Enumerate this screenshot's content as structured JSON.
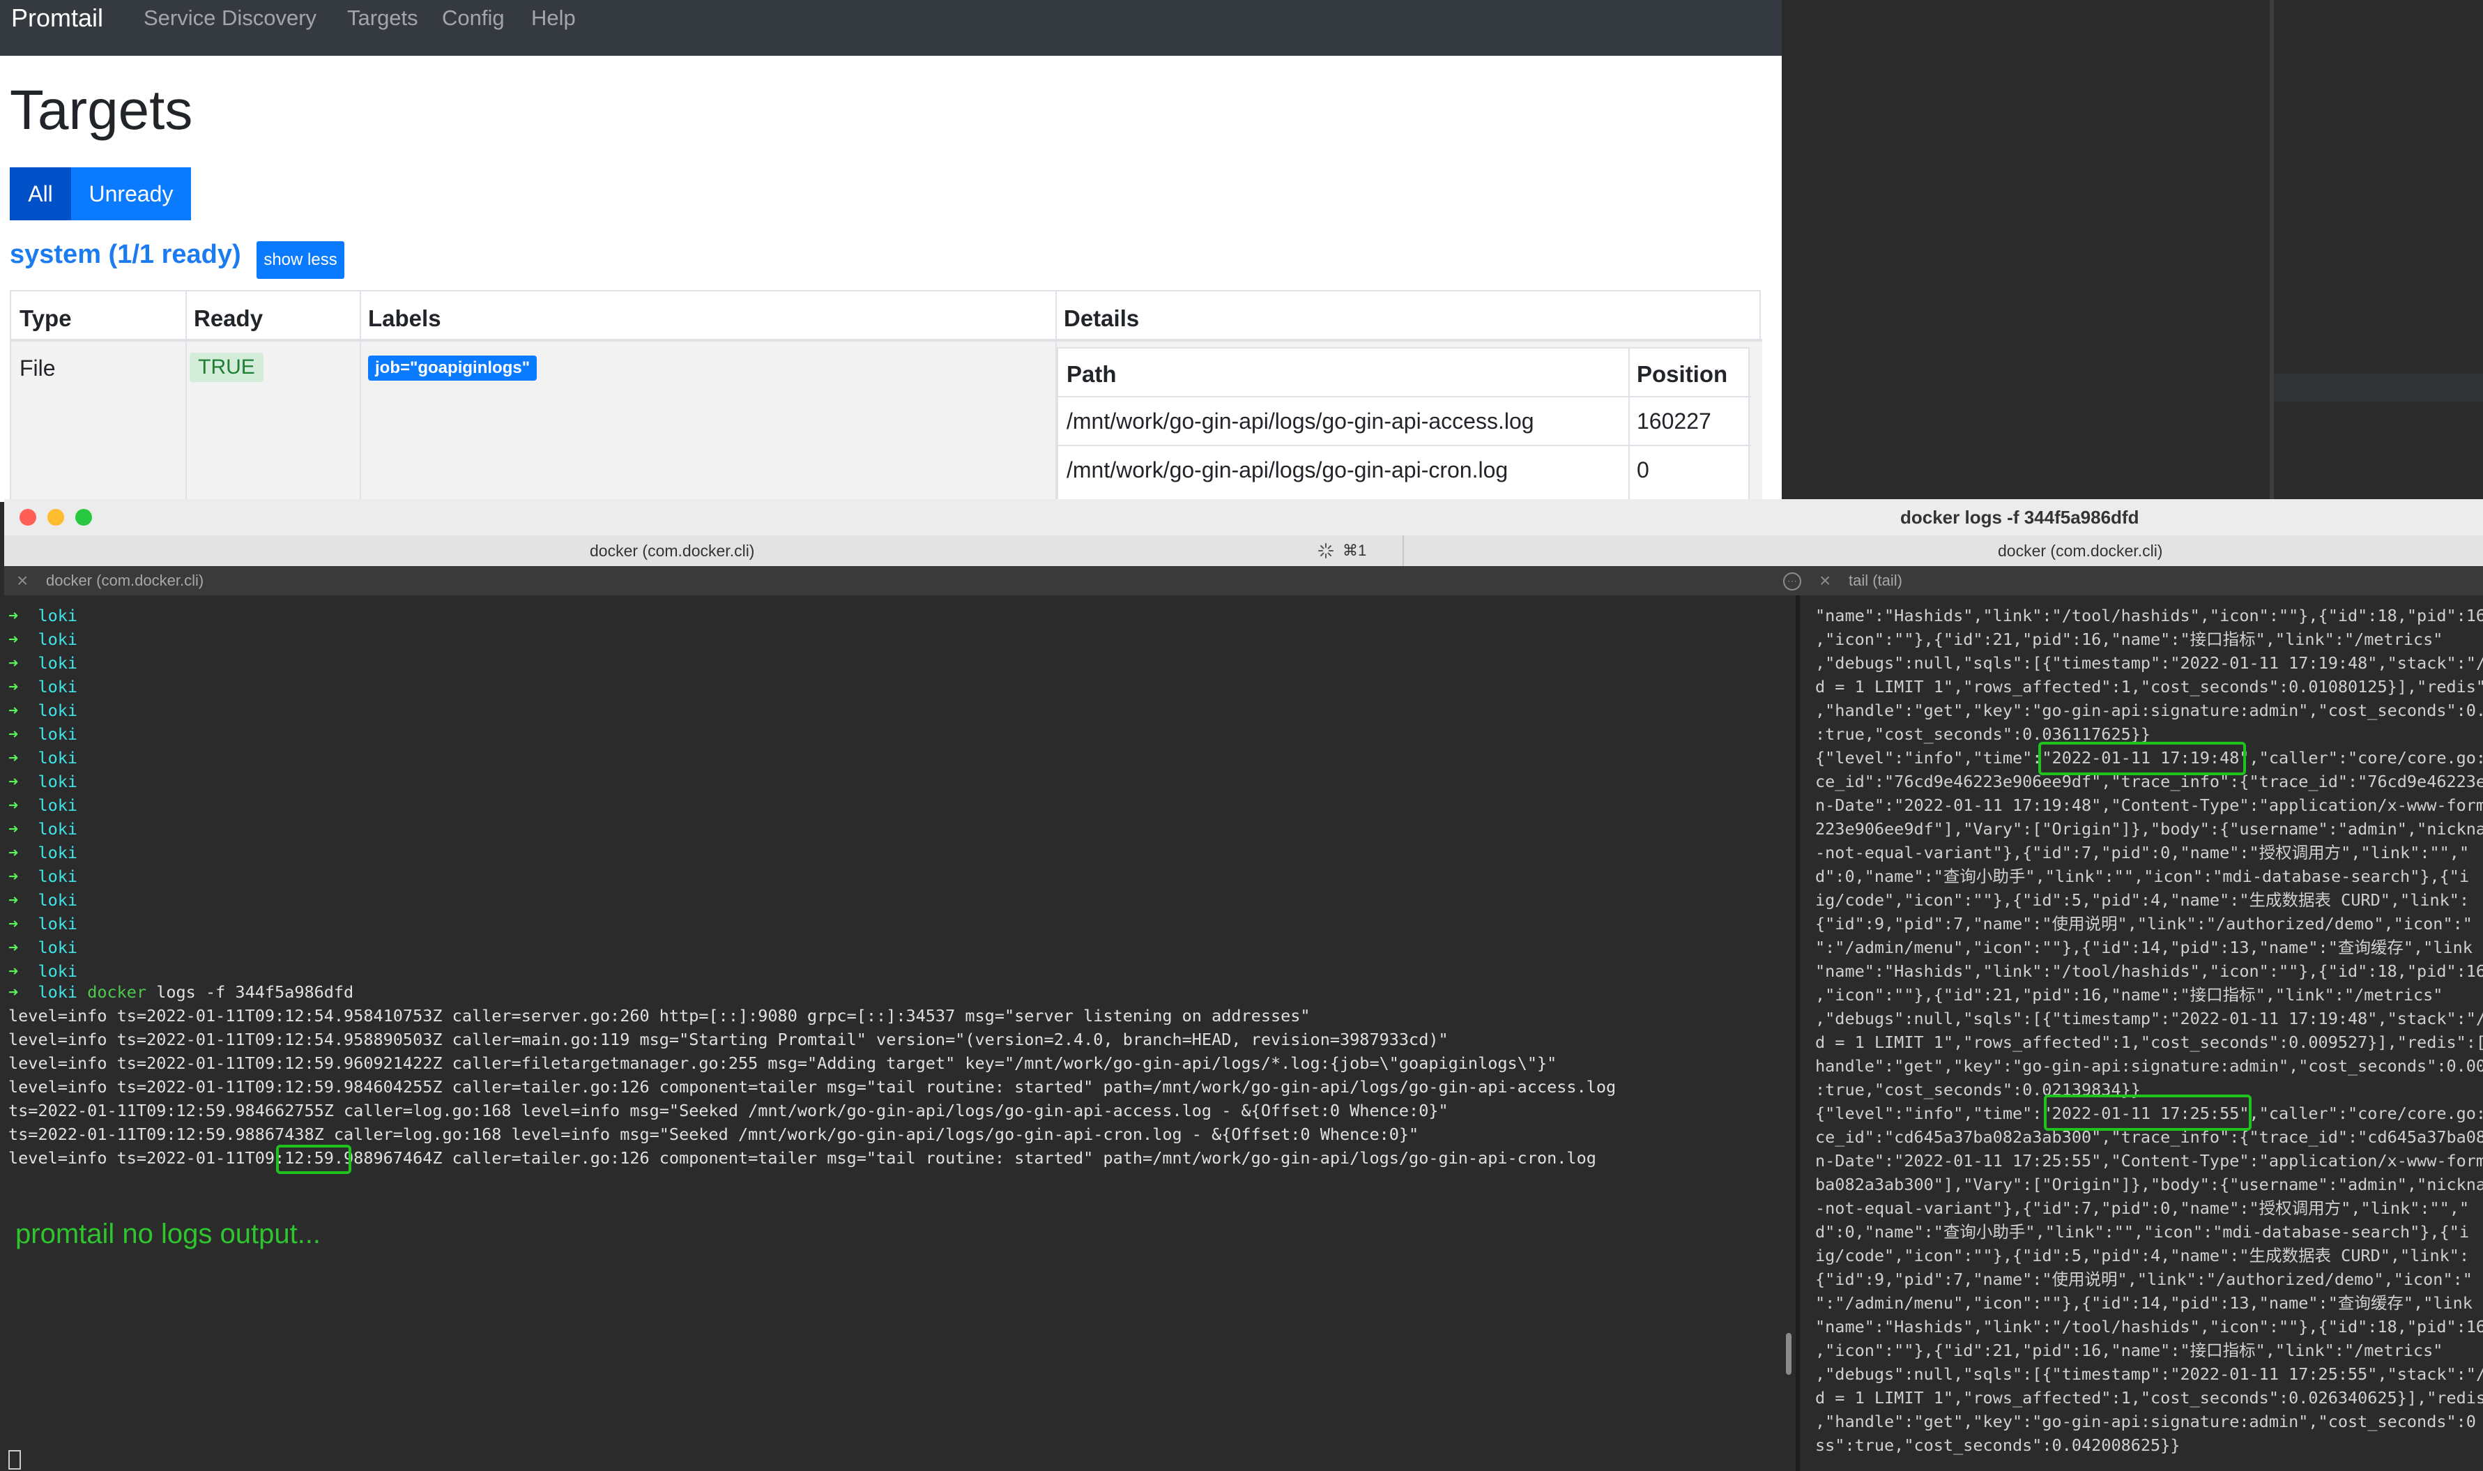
{
  "browser": {
    "brand": "Promtail",
    "nav": [
      "Service Discovery",
      "Targets",
      "Config",
      "Help"
    ],
    "page_title": "Targets",
    "filters": {
      "all": "All",
      "unready": "Unready"
    },
    "system_title": "system (1/1 ready)",
    "show_less": "show less",
    "table": {
      "headers": [
        "Type",
        "Ready",
        "Labels",
        "Details"
      ],
      "row": {
        "type": "File",
        "ready": "TRUE",
        "label": "job=\"goapiginlogs\""
      },
      "details": {
        "headers": [
          "Path",
          "Position"
        ],
        "rows": [
          {
            "path": "/mnt/work/go-gin-api/logs/go-gin-api-access.log",
            "position": "160227"
          },
          {
            "path": "/mnt/work/go-gin-api/logs/go-gin-api-cron.log",
            "position": "0"
          }
        ]
      }
    }
  },
  "terminal": {
    "window_title": "docker logs -f 344f5a986dfd",
    "tabs": [
      {
        "title": "docker (com.docker.cli)",
        "shortcut": "⌘1"
      },
      {
        "title": "docker (com.docker.cli)"
      }
    ],
    "panes": {
      "left": "docker (com.docker.cli)",
      "right": "tail (tail)"
    },
    "prompt": {
      "arrow": "➜",
      "dir": "loki"
    },
    "command": {
      "docker": "docker",
      "rest": " logs -f 344f5a986dfd"
    },
    "log_lines": [
      "level=info ts=2022-01-11T09:12:54.958410753Z caller=server.go:260 http=[::]:9080 grpc=[::]:34537 msg=\"server listening on addresses\"",
      "level=info ts=2022-01-11T09:12:54.958890503Z caller=main.go:119 msg=\"Starting Promtail\" version=\"(version=2.4.0, branch=HEAD, revision=3987933cd)\"",
      "level=info ts=2022-01-11T09:12:59.960921422Z caller=filetargetmanager.go:255 msg=\"Adding target\" key=\"/mnt/work/go-gin-api/logs/*.log:{job=\\\"goapiginlogs\\\"}\"",
      "level=info ts=2022-01-11T09:12:59.984604255Z caller=tailer.go:126 component=tailer msg=\"tail routine: started\" path=/mnt/work/go-gin-api/logs/go-gin-api-access.log",
      "ts=2022-01-11T09:12:59.984662755Z caller=log.go:168 level=info msg=\"Seeked /mnt/work/go-gin-api/logs/go-gin-api-access.log - &{Offset:0 Whence:0}\"",
      "ts=2022-01-11T09:12:59.98867438Z caller=log.go:168 level=info msg=\"Seeked /mnt/work/go-gin-api/logs/go-gin-api-cron.log - &{Offset:0 Whence:0}\"",
      "level=info ts=2022-01-11T09:12:59.988967464Z caller=tailer.go:126 component=tailer msg=\"tail routine: started\" path=/mnt/work/go-gin-api/logs/go-gin-api-cron.log"
    ],
    "note": "promtail no logs output...",
    "right_lines": [
      "\"name\":\"Hashids\",\"link\":\"/tool/hashids\",\"icon\":\"\"},{\"id\":18,\"pid\":16",
      ",\"icon\":\"\"},{\"id\":21,\"pid\":16,\"name\":\"接口指标\",\"link\":\"/metrics\"",
      ",\"debugs\":null,\"sqls\":[{\"timestamp\":\"2022-01-11 17:19:48\",\"stack\":\"/",
      "d = 1 LIMIT 1\",\"rows_affected\":1,\"cost_seconds\":0.01080125}],\"redis\"",
      ",\"handle\":\"get\",\"key\":\"go-gin-api:signature:admin\",\"cost_seconds\":0.",
      ":true,\"cost_seconds\":0.036117625}}",
      "{\"level\":\"info\",\"time\":\"2022-01-11 17:19:48\",\"caller\":\"core/core.go:",
      "ce_id\":\"76cd9e46223e906ee9df\",\"trace_info\":{\"trace_id\":\"76cd9e46223e9",
      "n-Date\":\"2022-01-11 17:19:48\",\"Content-Type\":\"application/x-www-form",
      "223e906ee9df\"],\"Vary\":[\"Origin\"]},\"body\":{\"username\":\"admin\",\"nickna",
      "-not-equal-variant\"},{\"id\":7,\"pid\":0,\"name\":\"授权调用方\",\"link\":\"\",\"",
      "d\":0,\"name\":\"查询小助手\",\"link\":\"\",\"icon\":\"mdi-database-search\"},{\"i",
      "ig/code\",\"icon\":\"\"},{\"id\":5,\"pid\":4,\"name\":\"生成数据表 CURD\",\"link\":",
      "{\"id\":9,\"pid\":7,\"name\":\"使用说明\",\"link\":\"/authorized/demo\",\"icon\":\"",
      "\":\"/admin/menu\",\"icon\":\"\"},{\"id\":14,\"pid\":13,\"name\":\"查询缓存\",\"link",
      "\"name\":\"Hashids\",\"link\":\"/tool/hashids\",\"icon\":\"\"},{\"id\":18,\"pid\":16",
      ",\"icon\":\"\"},{\"id\":21,\"pid\":16,\"name\":\"接口指标\",\"link\":\"/metrics\"",
      ",\"debugs\":null,\"sqls\":[{\"timestamp\":\"2022-01-11 17:19:48\",\"stack\":\"/",
      "d = 1 LIMIT 1\",\"rows_affected\":1,\"cost_seconds\":0.009527}],\"redis\":[",
      "handle\":\"get\",\"key\":\"go-gin-api:signature:admin\",\"cost_seconds\":0.00",
      ":true,\"cost_seconds\":0.02139834}}",
      "{\"level\":\"info\",\"time\":\"2022-01-11 17:25:55\",\"caller\":\"core/core.go:",
      "ce_id\":\"cd645a37ba082a3ab300\",\"trace_info\":{\"trace_id\":\"cd645a37ba08",
      "n-Date\":\"2022-01-11 17:25:55\",\"Content-Type\":\"application/x-www-form",
      "ba082a3ab300\"],\"Vary\":[\"Origin\"]},\"body\":{\"username\":\"admin\",\"nickna",
      "-not-equal-variant\"},{\"id\":7,\"pid\":0,\"name\":\"授权调用方\",\"link\":\"\",\"",
      "d\":0,\"name\":\"查询小助手\",\"link\":\"\",\"icon\":\"mdi-database-search\"},{\"i",
      "ig/code\",\"icon\":\"\"},{\"id\":5,\"pid\":4,\"name\":\"生成数据表 CURD\",\"link\":",
      "{\"id\":9,\"pid\":7,\"name\":\"使用说明\",\"link\":\"/authorized/demo\",\"icon\":\"",
      "\":\"/admin/menu\",\"icon\":\"\"},{\"id\":14,\"pid\":13,\"name\":\"查询缓存\",\"link",
      "\"name\":\"Hashids\",\"link\":\"/tool/hashids\",\"icon\":\"\"},{\"id\":18,\"pid\":16",
      ",\"icon\":\"\"},{\"id\":21,\"pid\":16,\"name\":\"接口指标\",\"link\":\"/metrics\"",
      ",\"debugs\":null,\"sqls\":[{\"timestamp\":\"2022-01-11 17:25:55\",\"stack\":\"/",
      "d = 1 LIMIT 1\",\"rows_affected\":1,\"cost_seconds\":0.026340625}],\"redis",
      ",\"handle\":\"get\",\"key\":\"go-gin-api:signature:admin\",\"cost_seconds\":0",
      "ss\":true,\"cost_seconds\":0.042008625}}"
    ]
  }
}
